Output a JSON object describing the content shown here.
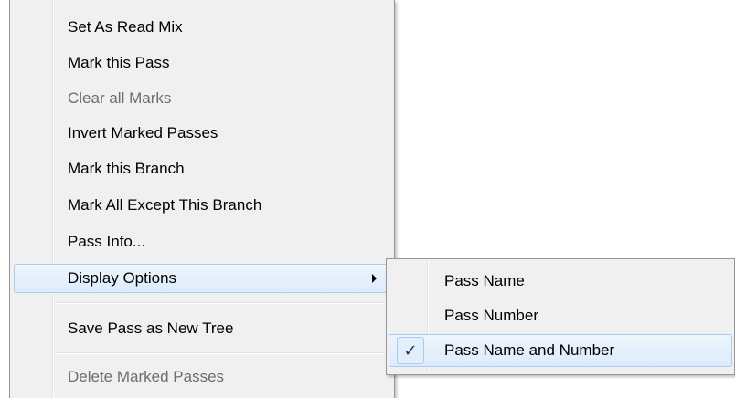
{
  "context_menu": {
    "items": [
      {
        "label": "Set As Read Mix",
        "enabled": true
      },
      {
        "label": "Mark this Pass",
        "enabled": true
      },
      {
        "label": "Clear all Marks",
        "enabled": false
      },
      {
        "label": "Invert Marked Passes",
        "enabled": true
      },
      {
        "label": "Mark this Branch",
        "enabled": true
      },
      {
        "label": "Mark All Except This Branch",
        "enabled": true
      },
      {
        "label": "Pass Info...",
        "enabled": true
      },
      {
        "label": "Display Options",
        "enabled": true,
        "highlighted": true,
        "has_submenu": true
      },
      {
        "label": "Save Pass as New Tree",
        "enabled": true
      },
      {
        "label": "Delete Marked Passes",
        "enabled": false
      }
    ]
  },
  "submenu": {
    "items": [
      {
        "label": "Pass Name",
        "checked": false
      },
      {
        "label": "Pass Number",
        "checked": false
      },
      {
        "label": "Pass Name and Number",
        "checked": true,
        "highlighted": true
      }
    ],
    "check_glyph": "✓"
  },
  "colors": {
    "menu_bg": "#f0f0f0",
    "highlight_border": "#aaccf0",
    "disabled_text": "#6d6d6d"
  }
}
